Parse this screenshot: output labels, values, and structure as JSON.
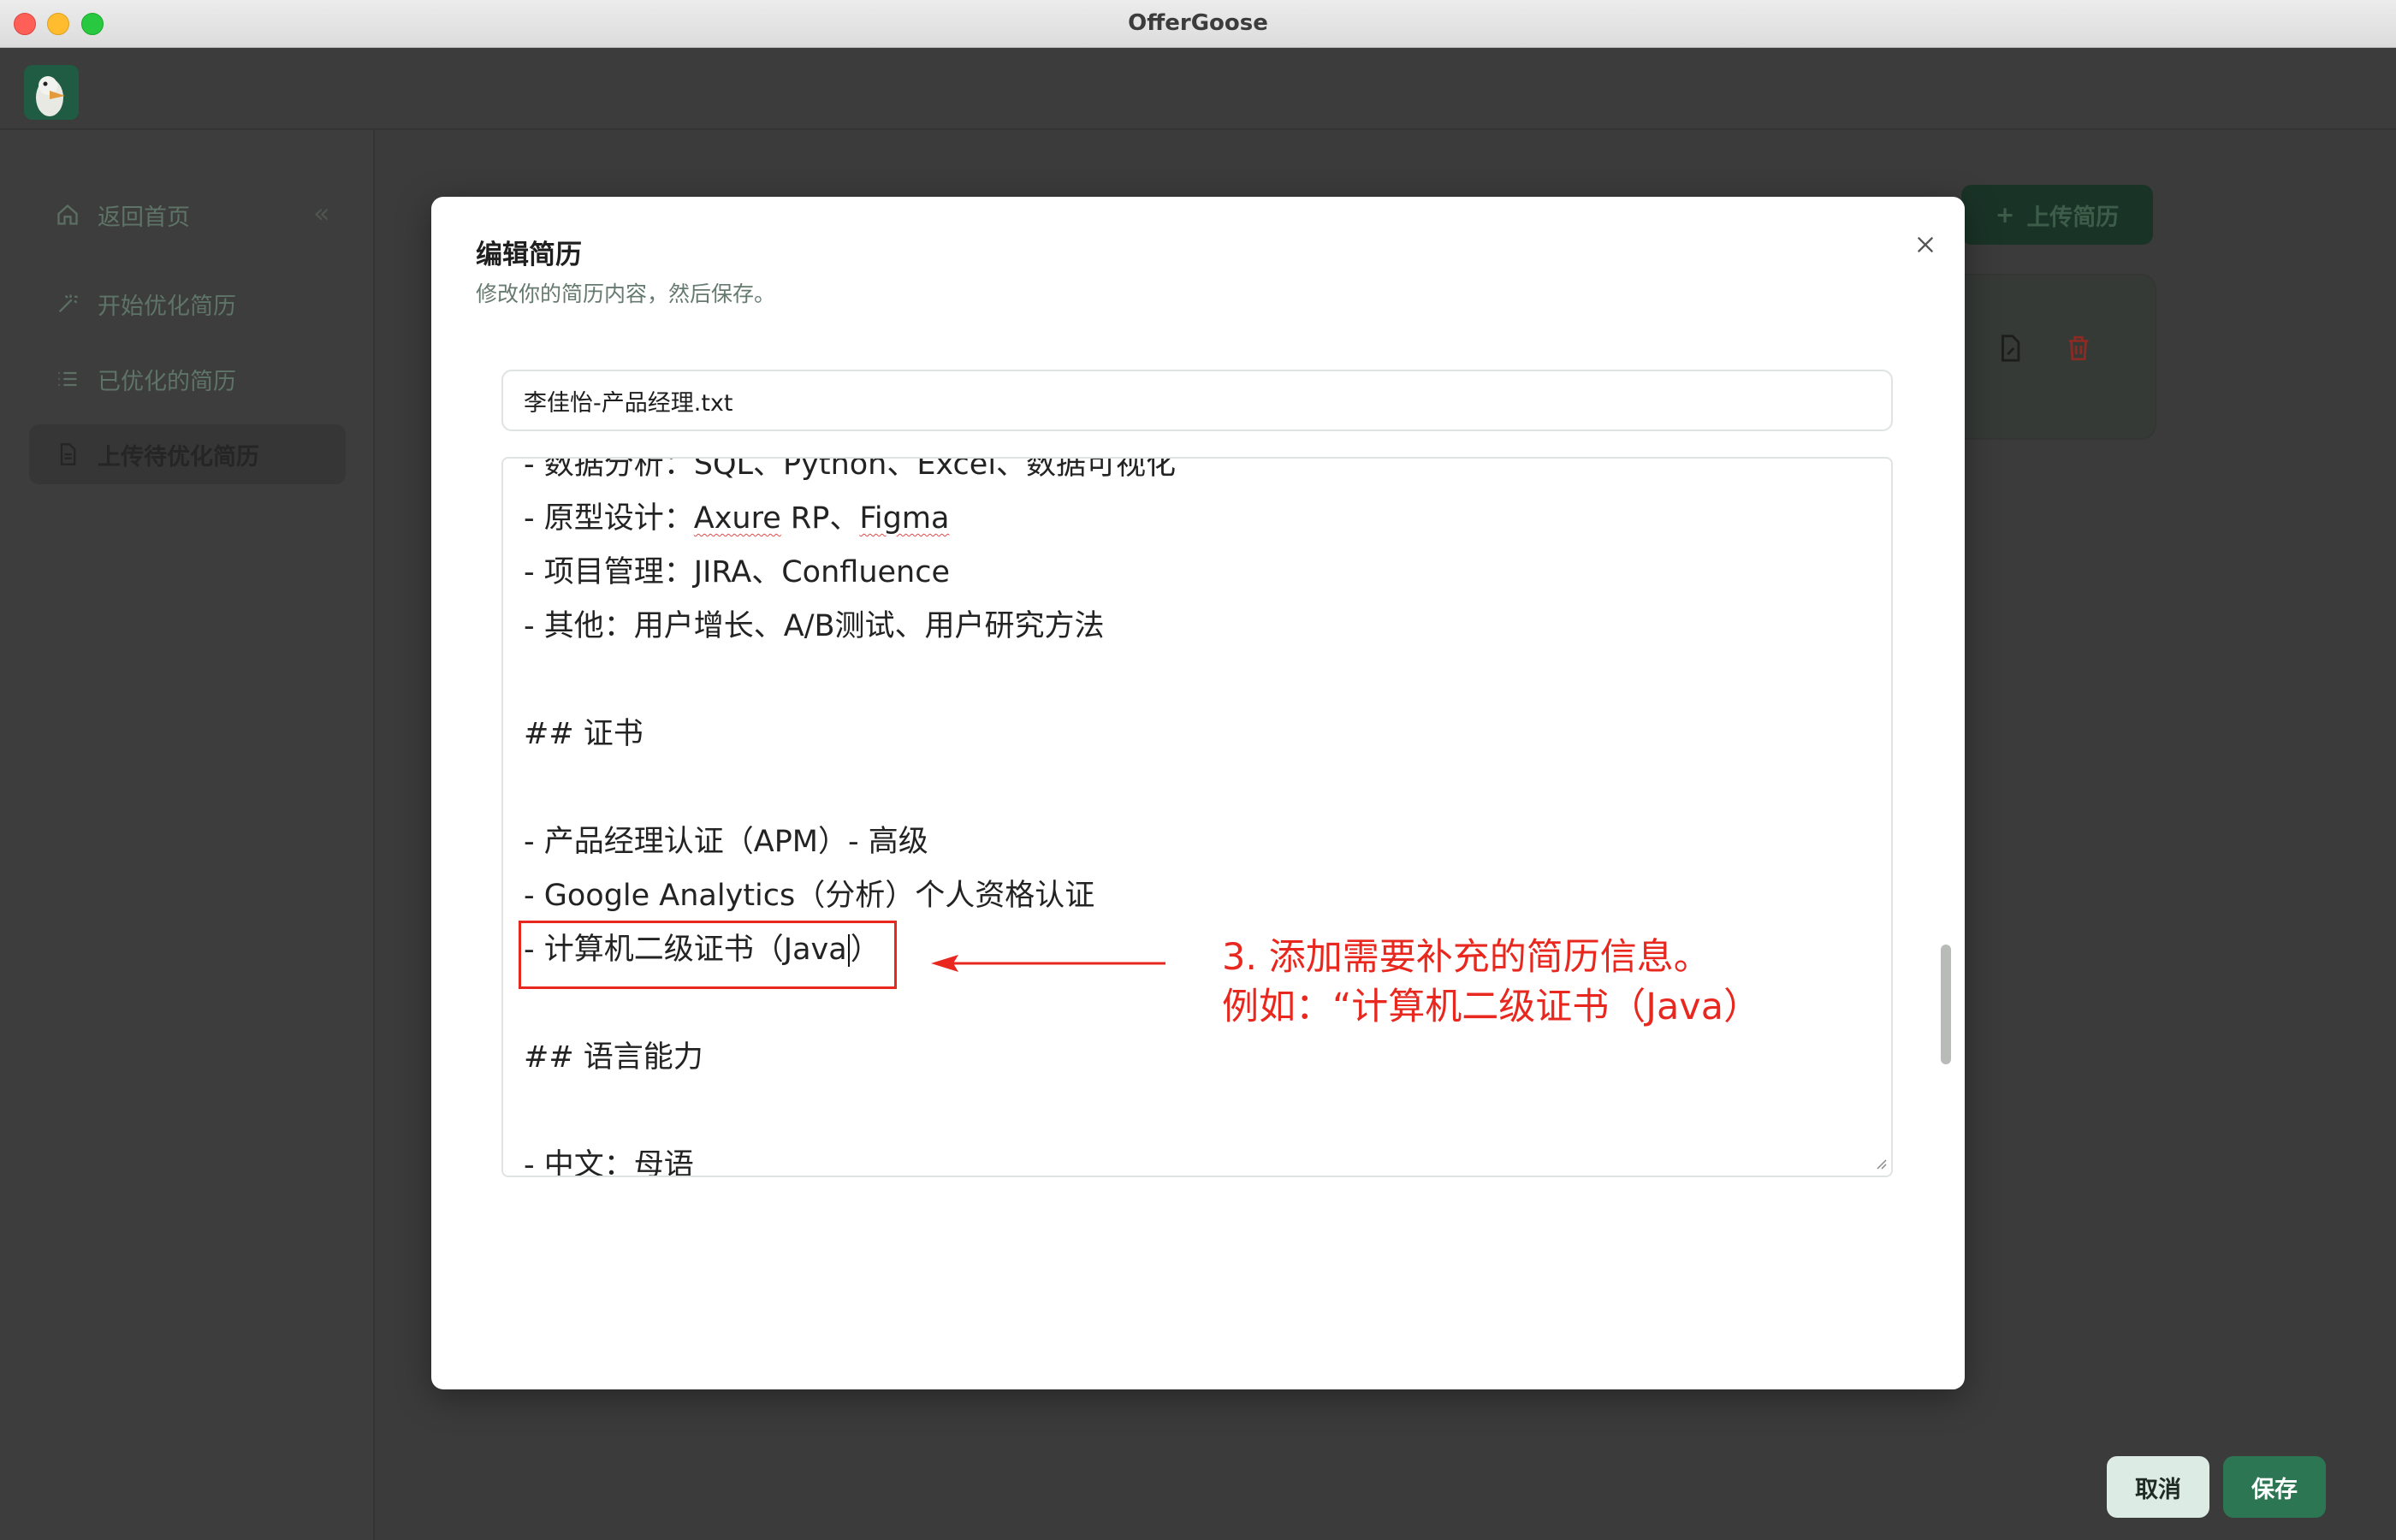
{
  "window": {
    "title": "OfferGoose"
  },
  "sidebar": {
    "items": [
      {
        "label": "返回首页",
        "icon": "home-icon"
      },
      {
        "label": "开始优化简历",
        "icon": "magic-wand-icon"
      },
      {
        "label": "已优化的简历",
        "icon": "list-icon"
      },
      {
        "label": "上传待优化简历",
        "icon": "document-icon",
        "active": true
      }
    ]
  },
  "main": {
    "upload_button_label": "上传简历"
  },
  "modal": {
    "title": "编辑简历",
    "subtitle": "修改你的简历内容，然后保存。",
    "filename": "李佳怡-产品经理.txt",
    "editor_lines": [
      "- 数据分析：SQL、Python、Excel、数据可视化",
      "- 原型设计：Axure RP、Figma",
      "- 项目管理：JIRA、Confluence",
      "- 其他：用户增长、A/B测试、用户研究方法",
      "",
      "## 证书",
      "",
      "- 产品经理认证（APM）- 高级",
      "- Google Analytics（分析）个人资格认证",
      "- 计算机二级证书（Java）",
      "",
      "## 语言能力",
      "",
      "- 中文：母语"
    ],
    "cancel_label": "取消",
    "save_label": "保存"
  },
  "annotation": {
    "line1": "3. 添加需要补充的简历信息。",
    "line2": "例如：“计算机二级证书（Java）"
  },
  "colors": {
    "accent": "#2d7653",
    "annotation_red": "#e8281f",
    "delete_red": "#b3322a"
  }
}
